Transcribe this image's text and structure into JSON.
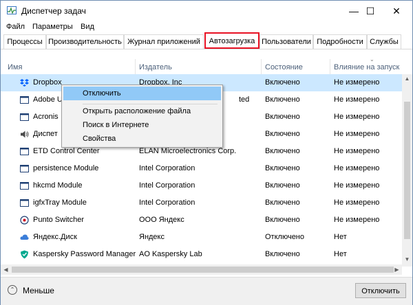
{
  "window": {
    "title": "Диспетчер задач",
    "minimize_glyph": "—",
    "maximize_glyph": "☐",
    "close_glyph": "✕"
  },
  "menu": [
    "Файл",
    "Параметры",
    "Вид"
  ],
  "tabs": [
    "Процессы",
    "Производительность",
    "Журнал приложений",
    "Автозагрузка",
    "Пользователи",
    "Подробности",
    "Службы"
  ],
  "active_tab": "Автозагрузка",
  "columns": [
    "Имя",
    "Издатель",
    "Состояние",
    "Влияние на запуск"
  ],
  "rows": [
    {
      "name": "Dropbox",
      "publisher": "Dropbox, Inc",
      "status": "Включено",
      "impact": "Не измерено",
      "icon": "dropbox-icon"
    },
    {
      "name": "Adobe U",
      "publisher": "ted",
      "status": "Включено",
      "impact": "Не измерено",
      "icon": "window-icon"
    },
    {
      "name": "Acronis",
      "publisher": "",
      "status": "Включено",
      "impact": "Не измерено",
      "icon": "window-icon"
    },
    {
      "name": "Диспет",
      "publisher": "",
      "status": "Включено",
      "impact": "Не измерено",
      "icon": "speaker-icon"
    },
    {
      "name": "ETD Control Center",
      "publisher": "ELAN Microelectronics Corp.",
      "status": "Включено",
      "impact": "Не измерено",
      "icon": "window-icon"
    },
    {
      "name": "persistence Module",
      "publisher": "Intel Corporation",
      "status": "Включено",
      "impact": "Не измерено",
      "icon": "window-icon"
    },
    {
      "name": "hkcmd Module",
      "publisher": "Intel Corporation",
      "status": "Включено",
      "impact": "Не измерено",
      "icon": "window-icon"
    },
    {
      "name": "igfxTray Module",
      "publisher": "Intel Corporation",
      "status": "Включено",
      "impact": "Не измерено",
      "icon": "window-icon"
    },
    {
      "name": "Punto Switcher",
      "publisher": "ООО Яндекс",
      "status": "Включено",
      "impact": "Не измерено",
      "icon": "punto-icon"
    },
    {
      "name": "Яндекс.Диск",
      "publisher": "Яндекс",
      "status": "Отключено",
      "impact": "Нет",
      "icon": "cloud-icon"
    },
    {
      "name": "Kaspersky Password Manager",
      "publisher": "AO Kaspersky Lab",
      "status": "Включено",
      "impact": "Нет",
      "icon": "shield-icon"
    }
  ],
  "context_menu": [
    "Отключить",
    "Открыть расположение файла",
    "Поиск в Интернете",
    "Свойства"
  ],
  "footer": {
    "less_label": "Меньше",
    "disable_button": "Отключить"
  },
  "colors": {
    "selected_row": "#cce8ff",
    "active_tab_border": "#e81123",
    "context_highlight": "#91c9f7",
    "header_text": "#4c607a"
  }
}
